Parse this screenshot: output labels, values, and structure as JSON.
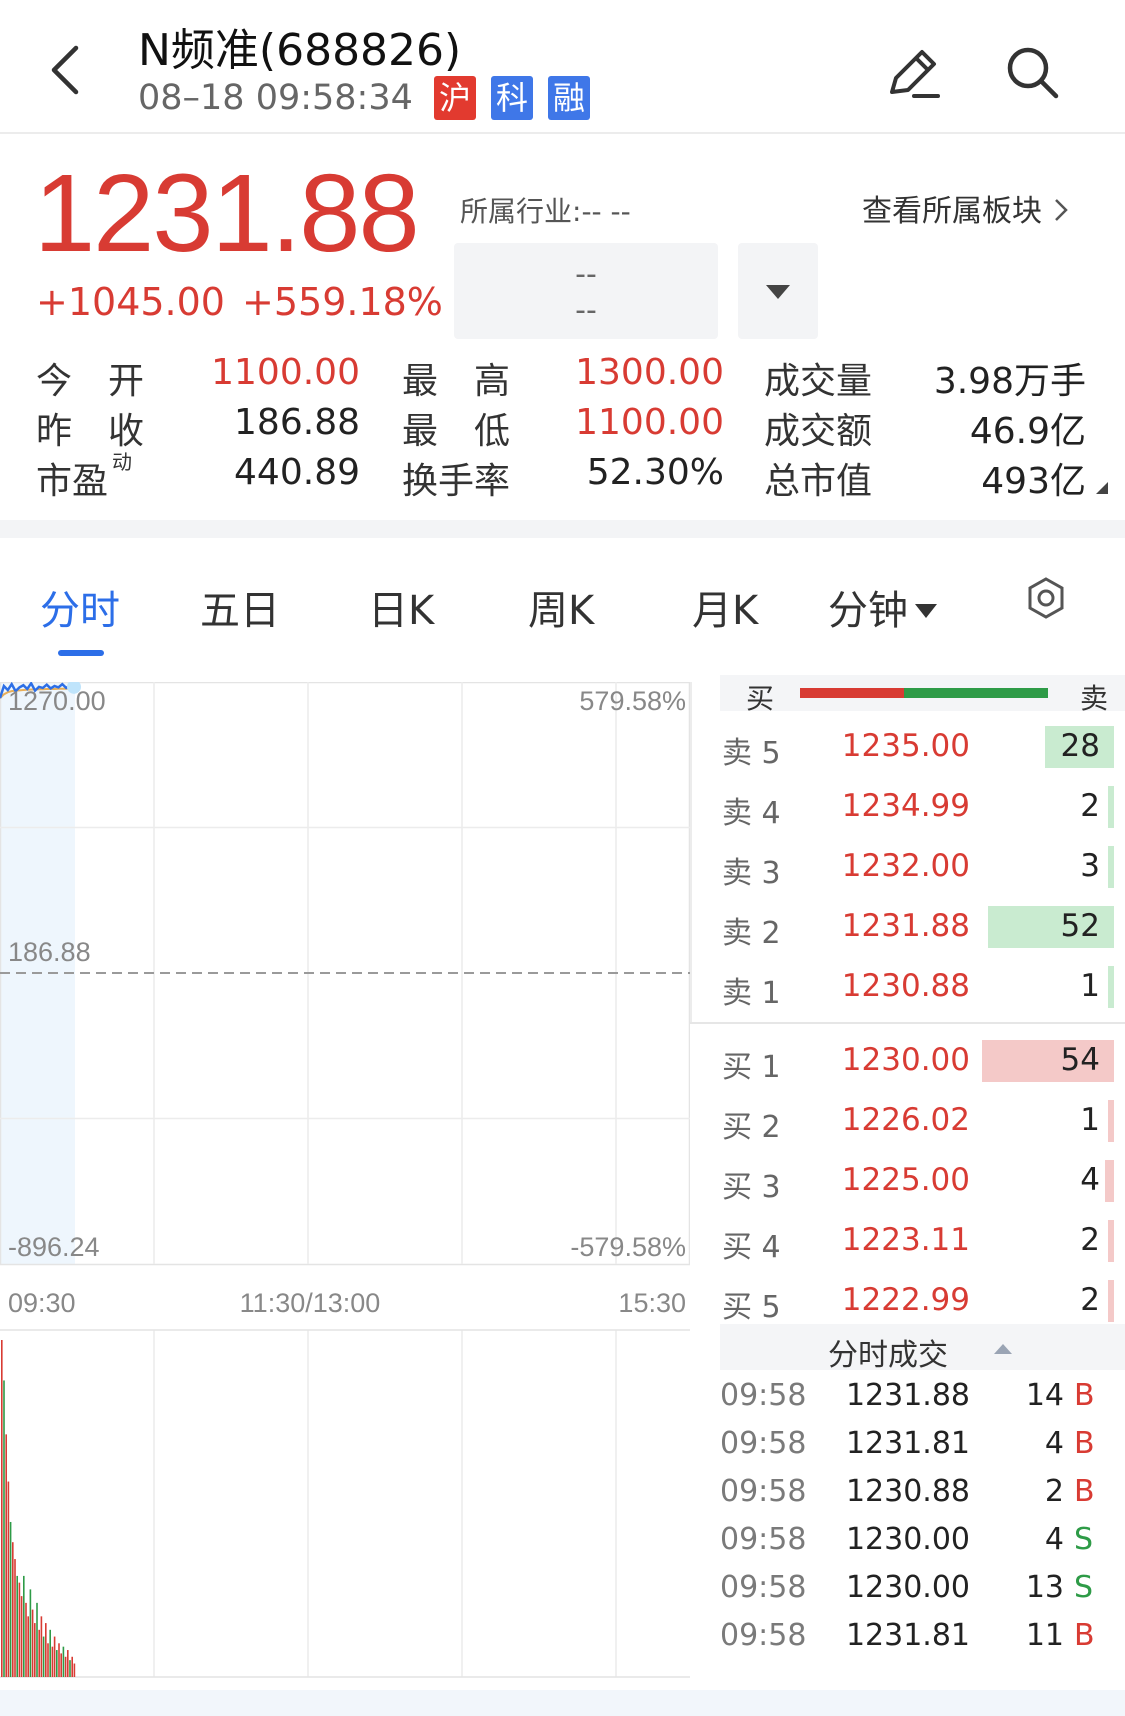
{
  "header": {
    "back_icon": "chevron-left-icon",
    "title": "N频准(688826)",
    "timestamp": "08–18 09:58:34",
    "tags": [
      {
        "label": "沪",
        "color": "#e23a2f"
      },
      {
        "label": "科",
        "color": "#3f77e8"
      },
      {
        "label": "融",
        "color": "#3f77e8"
      }
    ],
    "edit_icon": "edit-pencil-icon",
    "search_icon": "search-icon"
  },
  "quote": {
    "price": "1231.88",
    "change": "+1045.00",
    "change_pct": "+559.18%",
    "industry_label": "所属行业:",
    "industry_value": "-- --",
    "sector_link": "查看所属板块",
    "sector_box_top": "--",
    "sector_box_bottom": "--",
    "stats": [
      {
        "label": "今　开",
        "value": "1100.00",
        "color": "red"
      },
      {
        "label": "最　高",
        "value": "1300.00",
        "color": "red"
      },
      {
        "label": "成交量",
        "value": "3.98万手",
        "color": "dark"
      },
      {
        "label": "昨　收",
        "value": "186.88",
        "color": "dark"
      },
      {
        "label": "最　低",
        "value": "1100.00",
        "color": "red"
      },
      {
        "label": "成交额",
        "value": "46.9亿",
        "color": "dark"
      },
      {
        "label": "市盈",
        "label_sup": "动",
        "value": "440.89",
        "color": "dark"
      },
      {
        "label": "换手率",
        "value": "52.30%",
        "color": "dark"
      },
      {
        "label": "总市值",
        "value": "493亿",
        "color": "dark"
      }
    ]
  },
  "tabs": [
    {
      "label": "分时",
      "active": true
    },
    {
      "label": "五日",
      "active": false
    },
    {
      "label": "日K",
      "active": false
    },
    {
      "label": "周K",
      "active": false
    },
    {
      "label": "月K",
      "active": false
    },
    {
      "label": "分钟",
      "active": false
    }
  ],
  "settings_icon": "settings-ring-icon",
  "chart_data": {
    "type": "line",
    "y_left_ticks": [
      "1270.00",
      "186.88",
      "-896.24"
    ],
    "y_right_ticks": [
      "579.58%",
      "-579.58%"
    ],
    "x_ticks": [
      "09:30",
      "11:30/13:00",
      "15:30"
    ],
    "prev_close": 186.88,
    "ylim": [
      -896.24,
      1270.0
    ],
    "price_series": [
      1210,
      1255,
      1240,
      1262,
      1236,
      1250,
      1258,
      1244,
      1265,
      1238,
      1252,
      1248,
      1260,
      1246,
      1255,
      1250,
      1262,
      1248,
      1256,
      1252
    ],
    "avg_series": [
      1210,
      1224,
      1232,
      1236,
      1238,
      1239,
      1240,
      1241,
      1242,
      1242,
      1243,
      1243,
      1244,
      1244,
      1244,
      1245,
      1245,
      1245,
      1245,
      1245
    ],
    "volume_series": [
      100,
      88,
      72,
      58,
      46,
      40,
      35,
      30,
      28,
      24,
      30,
      22,
      18,
      26,
      20,
      16,
      22,
      14,
      18,
      12,
      16,
      10,
      14,
      9,
      12,
      8,
      10,
      7,
      9,
      6,
      8,
      5,
      6,
      4
    ]
  },
  "order_book": {
    "header_buy": "买",
    "header_sell": "卖",
    "ratio_buy": 0.42,
    "asks": [
      {
        "label": "卖 5",
        "price": "1235.00",
        "volume": "28",
        "bar": 0.23
      },
      {
        "label": "卖 4",
        "price": "1234.99",
        "volume": "2",
        "bar": 0.02
      },
      {
        "label": "卖 3",
        "price": "1232.00",
        "volume": "3",
        "bar": 0.02
      },
      {
        "label": "卖 2",
        "price": "1231.88",
        "volume": "52",
        "bar": 0.42
      },
      {
        "label": "卖 1",
        "price": "1230.88",
        "volume": "1",
        "bar": 0.01
      }
    ],
    "bids": [
      {
        "label": "买 1",
        "price": "1230.00",
        "volume": "54",
        "bar": 0.44
      },
      {
        "label": "买 2",
        "price": "1226.02",
        "volume": "1",
        "bar": 0.01
      },
      {
        "label": "买 3",
        "price": "1225.00",
        "volume": "4",
        "bar": 0.03
      },
      {
        "label": "买 4",
        "price": "1223.11",
        "volume": "2",
        "bar": 0.02
      },
      {
        "label": "买 5",
        "price": "1222.99",
        "volume": "2",
        "bar": 0.02
      }
    ]
  },
  "ticks": {
    "title": "分时成交",
    "rows": [
      {
        "time": "09:58",
        "price": "1231.88",
        "volume": "14",
        "side": "B"
      },
      {
        "time": "09:58",
        "price": "1231.81",
        "volume": "4",
        "side": "B"
      },
      {
        "time": "09:58",
        "price": "1230.88",
        "volume": "2",
        "side": "B"
      },
      {
        "time": "09:58",
        "price": "1230.00",
        "volume": "4",
        "side": "S"
      },
      {
        "time": "09:58",
        "price": "1230.00",
        "volume": "13",
        "side": "S"
      },
      {
        "time": "09:58",
        "price": "1231.81",
        "volume": "11",
        "side": "B"
      }
    ]
  }
}
